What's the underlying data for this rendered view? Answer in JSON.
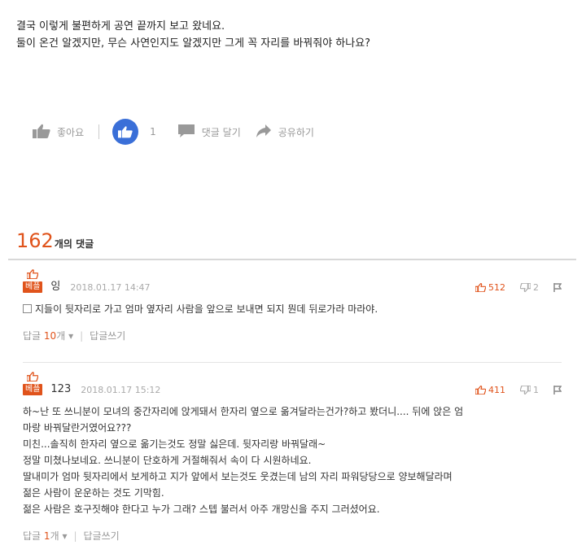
{
  "post": {
    "line1": "결국 이렇게 불편하게 공연 끝까지 보고 왔네요.",
    "line2": "둘이 온건 알겠지만, 무슨 사연인지도 알겠지만 그게 꼭 자리를 바꿔줘야 하나요?"
  },
  "actions": {
    "like_label": "좋아요",
    "like_count": "1",
    "comment_label": "댓글 달기",
    "share_label": "공유하기"
  },
  "comments_header": {
    "count": "162",
    "suffix": "개의 댓글"
  },
  "comments": [
    {
      "best": "베플",
      "author": "잉",
      "date": "2018.01.17 14:47",
      "up": "512",
      "down": "2",
      "text": "지들이 뒷자리로 가고 엄마 옆자리 사람을 앞으로 보내면 되지 뭔데 뒤로가라 마라야.",
      "reply_label": "답글",
      "reply_count": "10",
      "reply_unit": "개",
      "write_reply": "답글쓰기"
    },
    {
      "best": "베플",
      "author": "123",
      "date": "2018.01.17 15:12",
      "up": "411",
      "down": "1",
      "text": "하~난 또 쓰니분이 모녀의 중간자리에 앉게돼서 한자리 옆으로 옮겨달라는건가?하고 봤더니.... 뒤에 앉은 엄\n마랑 바꿔달란거였어요???\n미친...솔직히 한자리 옆으로 옮기는것도 정말 싫은데. 뒷자리랑 바꿔달래~\n정말 미쳤나보네요. 쓰니분이 단호하게 거절해줘서 속이 다 시원하네요.\n딸내미가 엄마 뒷자리에서 보게하고 지가 앞에서 보는것도 웃겼는데 남의 자리 파워당당으로 양보해달라며\n젊은 사람이 운운하는 것도 기막힘.\n젊은 사람은 호구짓해야 한다고 누가 그래? 스텝 불러서 아주 개망신을 주지 그러셨어요.",
      "reply_label": "답글",
      "reply_count": "1",
      "reply_unit": "개",
      "write_reply": "답글쓰기"
    }
  ],
  "colors": {
    "accent": "#e0531b",
    "like_blue": "#3a6fd8"
  },
  "icons": [
    "thumb-up-icon",
    "like-circle-icon",
    "comment-icon",
    "share-icon",
    "best-thumb-icon",
    "thumb-down-icon",
    "report-icon",
    "chevron-down-icon",
    "image-icon"
  ]
}
